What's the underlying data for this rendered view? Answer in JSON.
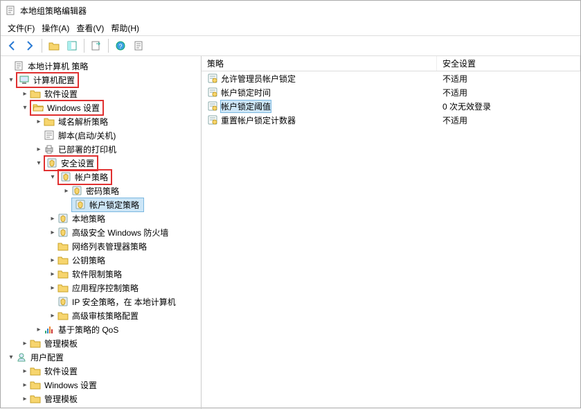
{
  "window": {
    "title": "本地组策略编辑器"
  },
  "menu": {
    "file": "文件(F)",
    "action": "操作(A)",
    "view": "查看(V)",
    "help": "帮助(H)"
  },
  "tree": {
    "root": "本地计算机 策略",
    "computer_config": "计算机配置",
    "software_settings": "软件设置",
    "windows_settings": "Windows 设置",
    "dns_policy": "域名解析策略",
    "scripts": "脚本(启动/关机)",
    "printers": "已部署的打印机",
    "security_settings": "安全设置",
    "account_policies": "帐户策略",
    "password_policy": "密码策略",
    "lockout_policy": "帐户锁定策略",
    "local_policies": "本地策略",
    "firewall": "高级安全 Windows 防火墙",
    "nlm_policy": "网络列表管理器策略",
    "public_key": "公钥策略",
    "software_restrict": "软件限制策略",
    "app_control": "应用程序控制策略",
    "ipsec": "IP 安全策略，在 本地计算机",
    "adv_audit": "高级审核策略配置",
    "qos": "基于策略的 QoS",
    "admin_templates": "管理模板",
    "user_config": "用户配置",
    "u_software": "软件设置",
    "u_windows": "Windows 设置",
    "u_admin": "管理模板"
  },
  "list": {
    "col_policy": "策略",
    "col_setting": "安全设置",
    "rows": [
      {
        "policy": "允许管理员帐户锁定",
        "setting": "不适用"
      },
      {
        "policy": "帐户锁定时间",
        "setting": "不适用"
      },
      {
        "policy": "帐户锁定阈值",
        "setting": "0 次无效登录"
      },
      {
        "policy": "重置帐户锁定计数器",
        "setting": "不适用"
      }
    ]
  }
}
